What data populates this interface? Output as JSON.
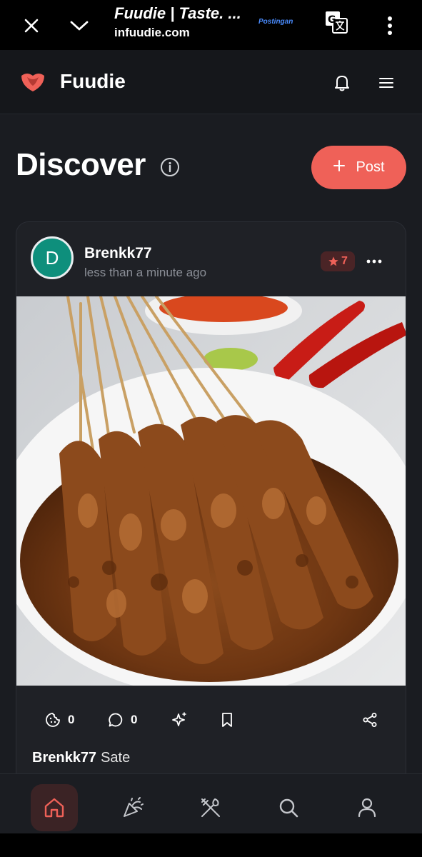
{
  "browser": {
    "title": "Fuudie | Taste. ...",
    "url": "infuudie.com",
    "badge": "Postingan",
    "icons": [
      "close-icon",
      "chevron-down-icon",
      "translate-icon",
      "more-vertical-icon"
    ]
  },
  "header": {
    "brand": "Fuudie",
    "icons": [
      "logo-icon",
      "bell-icon",
      "menu-icon"
    ]
  },
  "page": {
    "title": "Discover",
    "post_button": "Post"
  },
  "post": {
    "avatar_letter": "D",
    "username": "Brenkk77",
    "time": "less than a minute ago",
    "rating": "7",
    "likes": "0",
    "comments": "0",
    "caption_user": "Brenkk77",
    "caption_text": "Sate",
    "image_alt": "sate-photo"
  },
  "colors": {
    "accent": "#ef6158",
    "avatar": "#0e8f7c",
    "background": "#1a1c21",
    "card": "#1f2126"
  },
  "bottom_nav": {
    "items": [
      "home-icon",
      "party-icon",
      "utensils-icon",
      "search-icon",
      "user-icon"
    ],
    "active": "home-icon"
  }
}
